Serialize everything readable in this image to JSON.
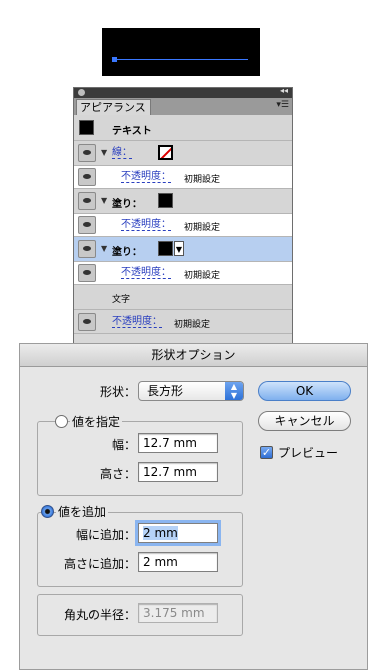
{
  "panel": {
    "tab": "アピアランス",
    "text_row": "テキスト",
    "rows": [
      {
        "label": "線：",
        "opacity_label": "不透明度：",
        "opacity_value": "初期設定"
      },
      {
        "label": "塗り：",
        "opacity_label": "不透明度：",
        "opacity_value": "初期設定"
      },
      {
        "label": "塗り：",
        "opacity_label": "不透明度：",
        "opacity_value": "初期設定"
      }
    ],
    "moji": "文字",
    "bottom_opacity_label": "不透明度：",
    "bottom_opacity_value": "初期設定"
  },
  "dialog": {
    "title": "形状オプション",
    "shape_label": "形状：",
    "shape_value": "長方形",
    "ok": "OK",
    "cancel": "キャンセル",
    "preview": "プレビュー",
    "absolute": {
      "legend": "値を指定",
      "width_label": "幅：",
      "width_value": "12.7 mm",
      "height_label": "高さ：",
      "height_value": "12.7 mm"
    },
    "relative": {
      "legend": "値を追加",
      "width_label": "幅に追加：",
      "width_value": "2 mm",
      "height_label": "高さに追加：",
      "height_value": "2 mm"
    },
    "corner_label": "角丸の半径：",
    "corner_value": "3.175 mm"
  }
}
